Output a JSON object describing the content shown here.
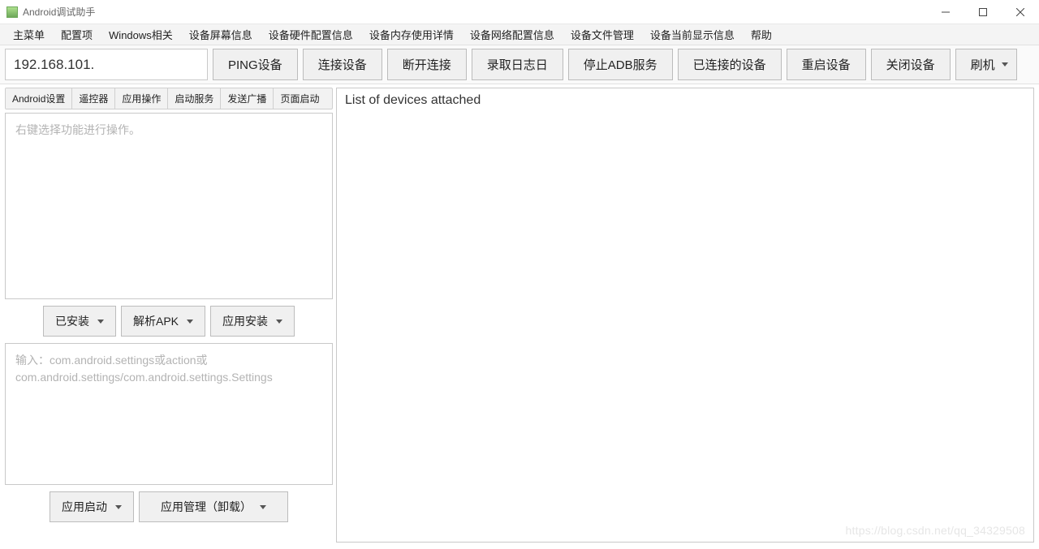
{
  "title": "Android调试助手",
  "menubar": [
    "主菜单",
    "配置项",
    "Windows相关",
    "设备屏幕信息",
    "设备硬件配置信息",
    "设备内存使用详情",
    "设备网络配置信息",
    "设备文件管理",
    "设备当前显示信息",
    "帮助"
  ],
  "toolbar": {
    "ip_value": "192.168.101.",
    "buttons": [
      "PING设备",
      "连接设备",
      "断开连接",
      "录取日志日",
      "停止ADB服务",
      "已连接的设备",
      "重启设备",
      "关闭设备"
    ],
    "flash_label": "刷机"
  },
  "subtabs": [
    "Android设置",
    "遥控器",
    "应用操作",
    "启动服务",
    "发送广播",
    "页面启动"
  ],
  "left": {
    "placeholder1": "右键选择功能进行操作。",
    "row1": {
      "installed": "已安装",
      "parse_apk": "解析APK",
      "install_app": "应用安装"
    },
    "placeholder2": "输入：com.android.settings或action或com.android.settings/com.android.settings.Settings",
    "row2": {
      "launch_app": "应用启动",
      "manage_app": "应用管理（卸载）"
    }
  },
  "right": {
    "output": "List of devices attached"
  },
  "watermark": "https://blog.csdn.net/qq_34329508"
}
